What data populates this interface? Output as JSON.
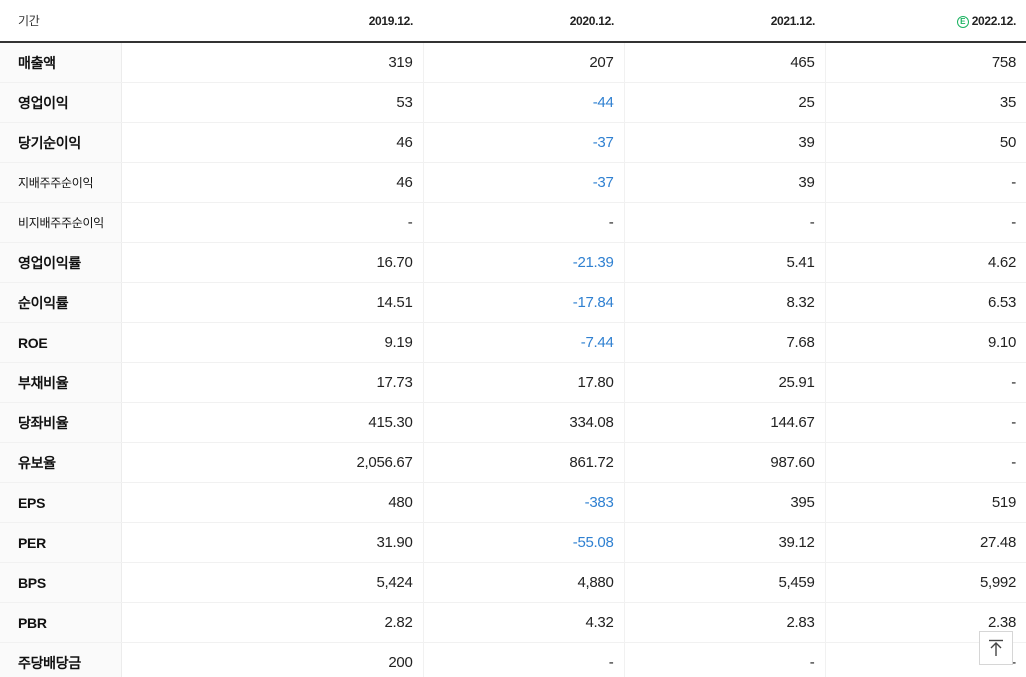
{
  "table": {
    "header_label": "기간",
    "columns": [
      {
        "label": "2019.12.",
        "estimate": false
      },
      {
        "label": "2020.12.",
        "estimate": false
      },
      {
        "label": "2021.12.",
        "estimate": false
      },
      {
        "label": "2022.12.",
        "estimate": true
      }
    ],
    "estimate_icon_text": "E",
    "rows": [
      {
        "label": "매출액",
        "values": [
          "319",
          "207",
          "465",
          "758"
        ]
      },
      {
        "label": "영업이익",
        "values": [
          "53",
          "-44",
          "25",
          "35"
        ]
      },
      {
        "label": "당기순이익",
        "values": [
          "46",
          "-37",
          "39",
          "50"
        ]
      },
      {
        "label": "지배주주순이익",
        "values": [
          "46",
          "-37",
          "39",
          "-"
        ]
      },
      {
        "label": "비지배주주순이익",
        "values": [
          "-",
          "-",
          "-",
          "-"
        ]
      },
      {
        "label": "영업이익률",
        "values": [
          "16.70",
          "-21.39",
          "5.41",
          "4.62"
        ]
      },
      {
        "label": "순이익률",
        "values": [
          "14.51",
          "-17.84",
          "8.32",
          "6.53"
        ]
      },
      {
        "label": "ROE",
        "values": [
          "9.19",
          "-7.44",
          "7.68",
          "9.10"
        ]
      },
      {
        "label": "부채비율",
        "values": [
          "17.73",
          "17.80",
          "25.91",
          "-"
        ]
      },
      {
        "label": "당좌비율",
        "values": [
          "415.30",
          "334.08",
          "144.67",
          "-"
        ]
      },
      {
        "label": "유보율",
        "values": [
          "2,056.67",
          "861.72",
          "987.60",
          "-"
        ]
      },
      {
        "label": "EPS",
        "values": [
          "480",
          "-383",
          "395",
          "519"
        ]
      },
      {
        "label": "PER",
        "values": [
          "31.90",
          "-55.08",
          "39.12",
          "27.48"
        ]
      },
      {
        "label": "BPS",
        "values": [
          "5,424",
          "4,880",
          "5,459",
          "5,992"
        ]
      },
      {
        "label": "PBR",
        "values": [
          "2.82",
          "4.32",
          "2.83",
          "2.38"
        ]
      },
      {
        "label": "주당배당금",
        "values": [
          "200",
          "-",
          "-",
          "-"
        ]
      }
    ]
  },
  "colors": {
    "negative": "#2f80d1",
    "estimate_icon": "#1bb361"
  },
  "scroll_top_button": {
    "icon": "arrow-up-to-top-icon"
  }
}
